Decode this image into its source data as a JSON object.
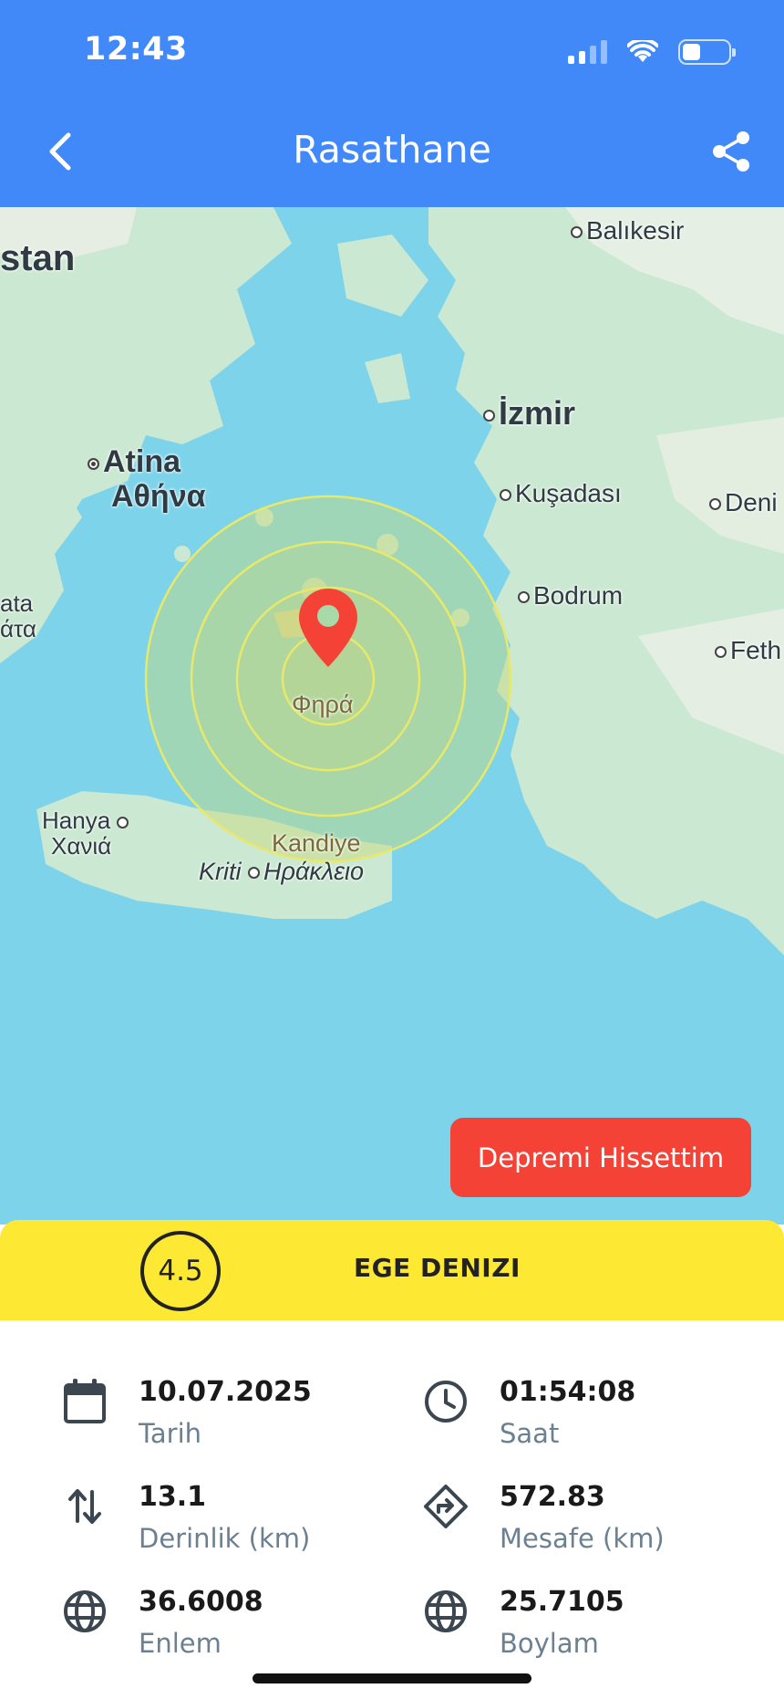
{
  "status": {
    "time": "12:43"
  },
  "header": {
    "title": "Rasathane"
  },
  "map": {
    "labels": {
      "stan": "stan",
      "balikesir": "Balıkesir",
      "izmir": "İzmir",
      "atina": "Atina",
      "athina_gr": "Αθήνα",
      "kusadasi": "Kuşadası",
      "deni": "Deni",
      "bata": "ata",
      "bata2": "άτα",
      "bodrum": "Bodrum",
      "feth": "Feth",
      "fira": "Φηρά",
      "hanya": "Hanya",
      "hanya_gr": "Χανιά",
      "kandiye": "Kandiye",
      "kriti": "Kriti",
      "iraklio": "Ηράκλειο"
    },
    "felt_button": "Depremi Hissettim",
    "colors": {
      "sea": "#7dd3ea",
      "land": "#cde9d6",
      "ring": "#e8e86a",
      "pin": "#f44336"
    }
  },
  "quake": {
    "magnitude": "4.5",
    "region": "EGE DENIZI"
  },
  "details": {
    "date": {
      "value": "10.07.2025",
      "label": "Tarih"
    },
    "time": {
      "value": "01:54:08",
      "label": "Saat"
    },
    "depth": {
      "value": "13.1",
      "label": "Derinlik (km)"
    },
    "distance": {
      "value": "572.83",
      "label": "Mesafe (km)"
    },
    "latitude": {
      "value": "36.6008",
      "label": "Enlem"
    },
    "longitude": {
      "value": "25.7105",
      "label": "Boylam"
    }
  }
}
